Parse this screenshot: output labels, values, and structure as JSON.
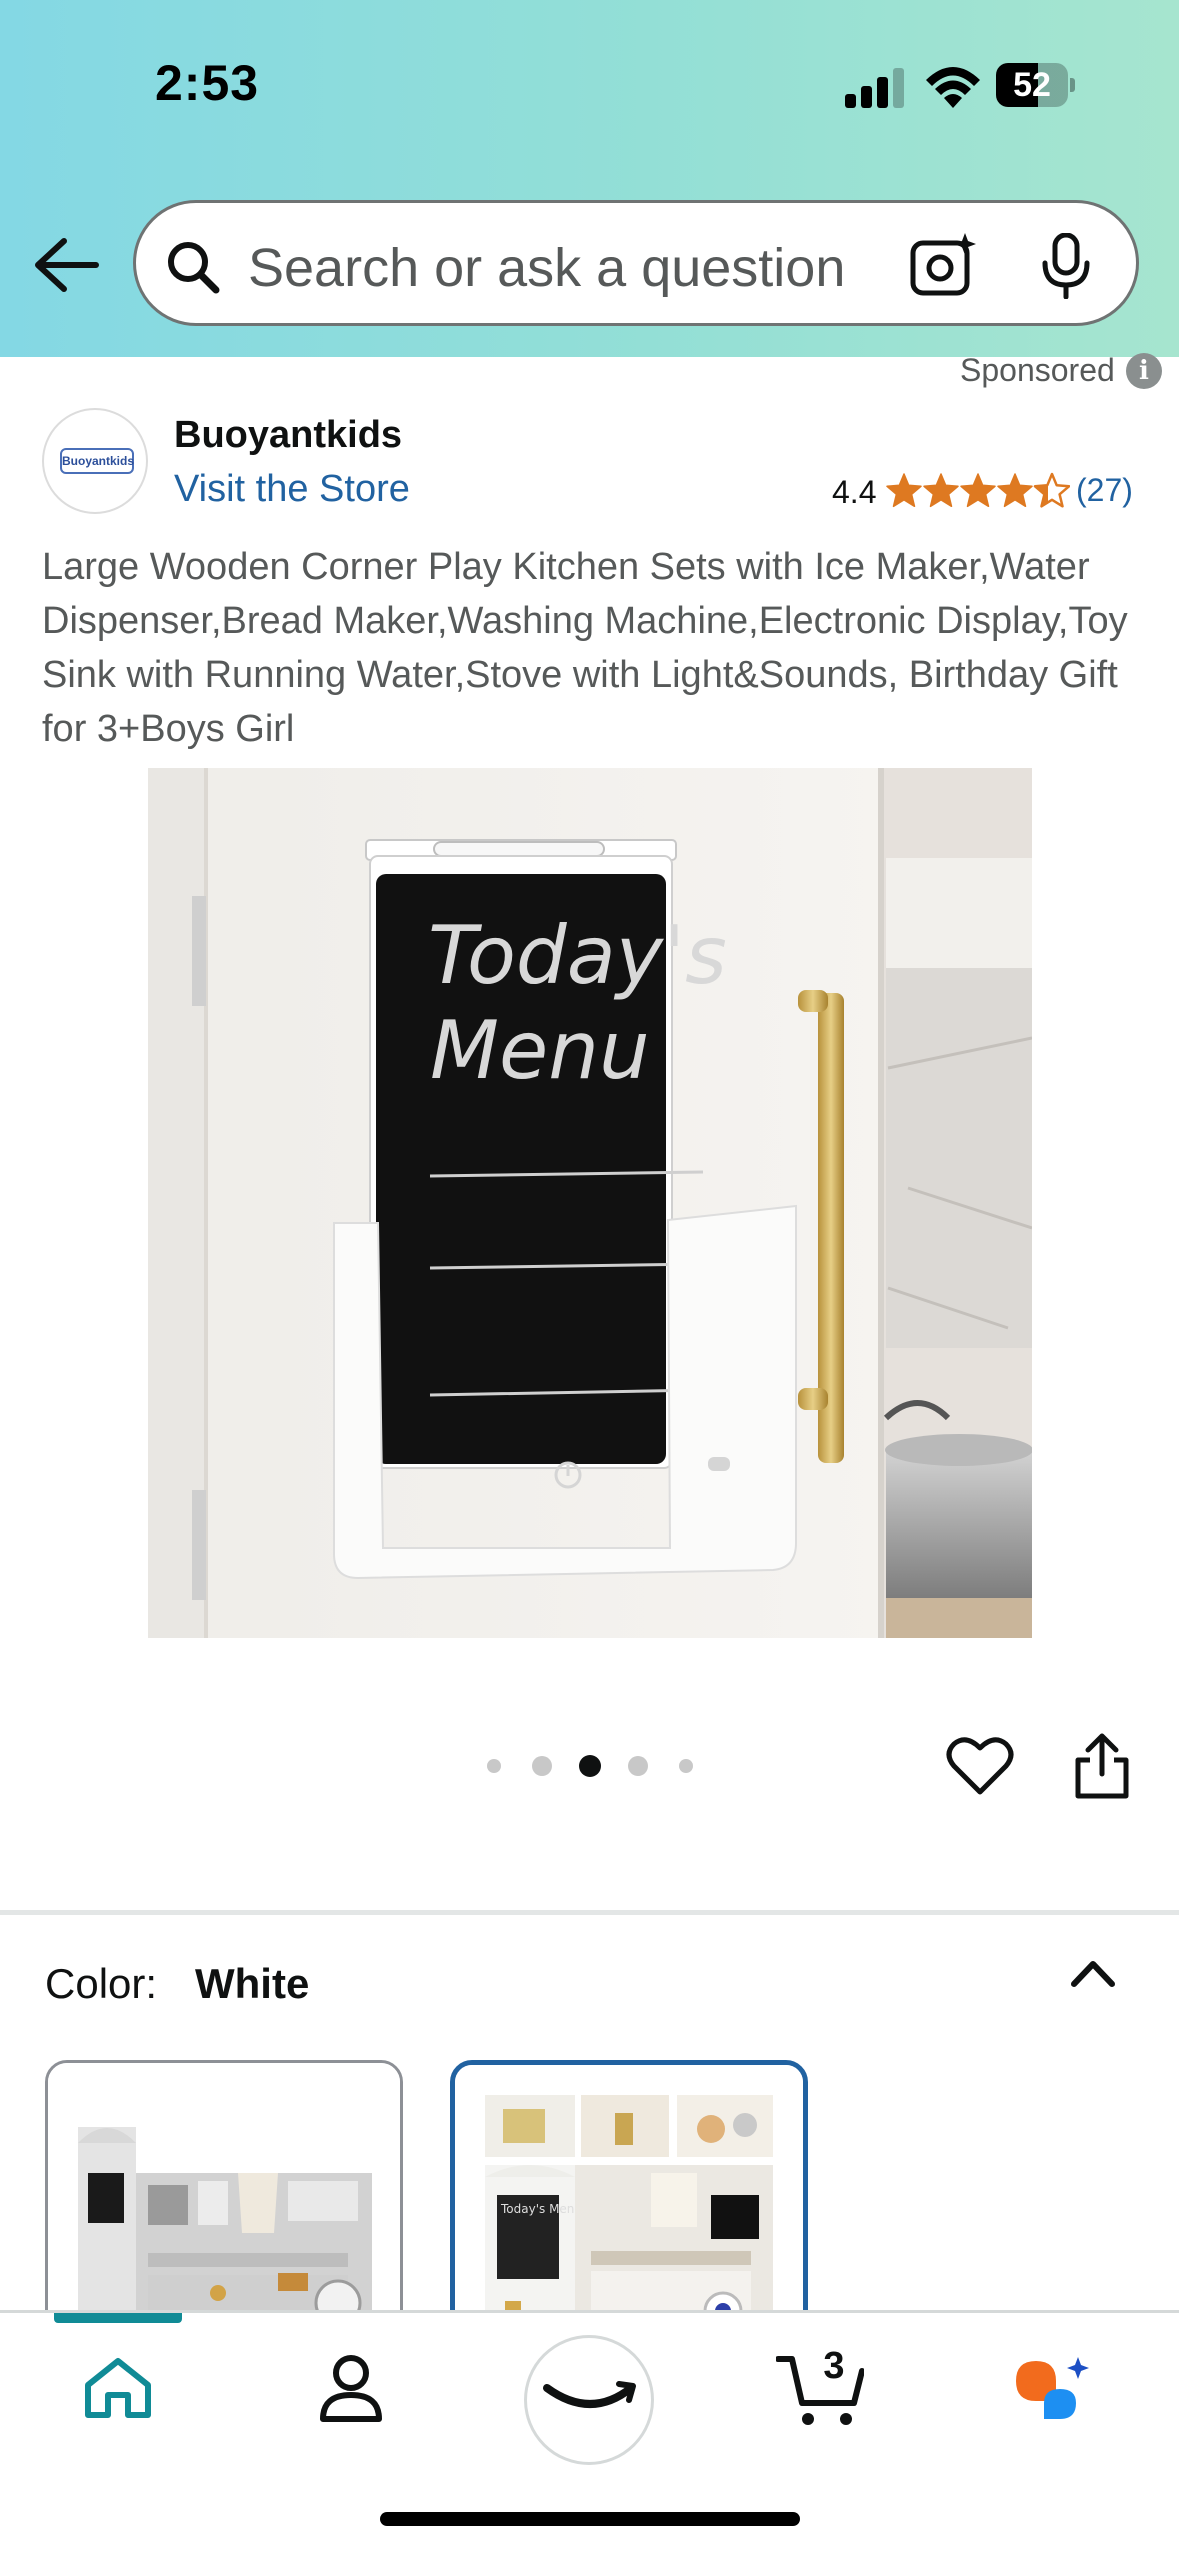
{
  "status_bar": {
    "time": "2:53",
    "battery": "52",
    "battery_level_percent": 52
  },
  "search": {
    "placeholder": "Search or ask a question"
  },
  "ad": {
    "sponsored_label": "Sponsored",
    "info_glyph": "i",
    "brand_logo_text": "Buoyantkids",
    "brand_name": "Buoyantkids",
    "visit_store": "Visit the Store",
    "rating": "4.4",
    "rating_stars": 4.4,
    "review_count": "(27)",
    "title": "Large Wooden Corner Play Kitchen Sets with Ice Maker,Water Dispenser,Bread Maker,Washing Machine,Electronic Display,Toy Sink with Running Water,Stove with Light&Sounds, Birthday Gift for 3+Boys Girl"
  },
  "product_image": {
    "board_line_1": "Today's",
    "board_line_2": "Menu"
  },
  "carousel": {
    "total": 5,
    "active_index": 2
  },
  "variant": {
    "color_label": "Color:",
    "color_value": "White",
    "swatches": [
      {
        "name": "grey-kitchen",
        "selected": false
      },
      {
        "name": "white-kitchen",
        "selected": true
      }
    ],
    "swatch2_board_text": "Today's Menu"
  },
  "nav": {
    "cart_count": "3",
    "items": [
      "home",
      "account",
      "amazon",
      "cart",
      "rufus"
    ]
  },
  "colors": {
    "link": "#2162a1",
    "star": "#de7921",
    "nav_accent": "#108b96",
    "selected_border": "#2162a1"
  }
}
